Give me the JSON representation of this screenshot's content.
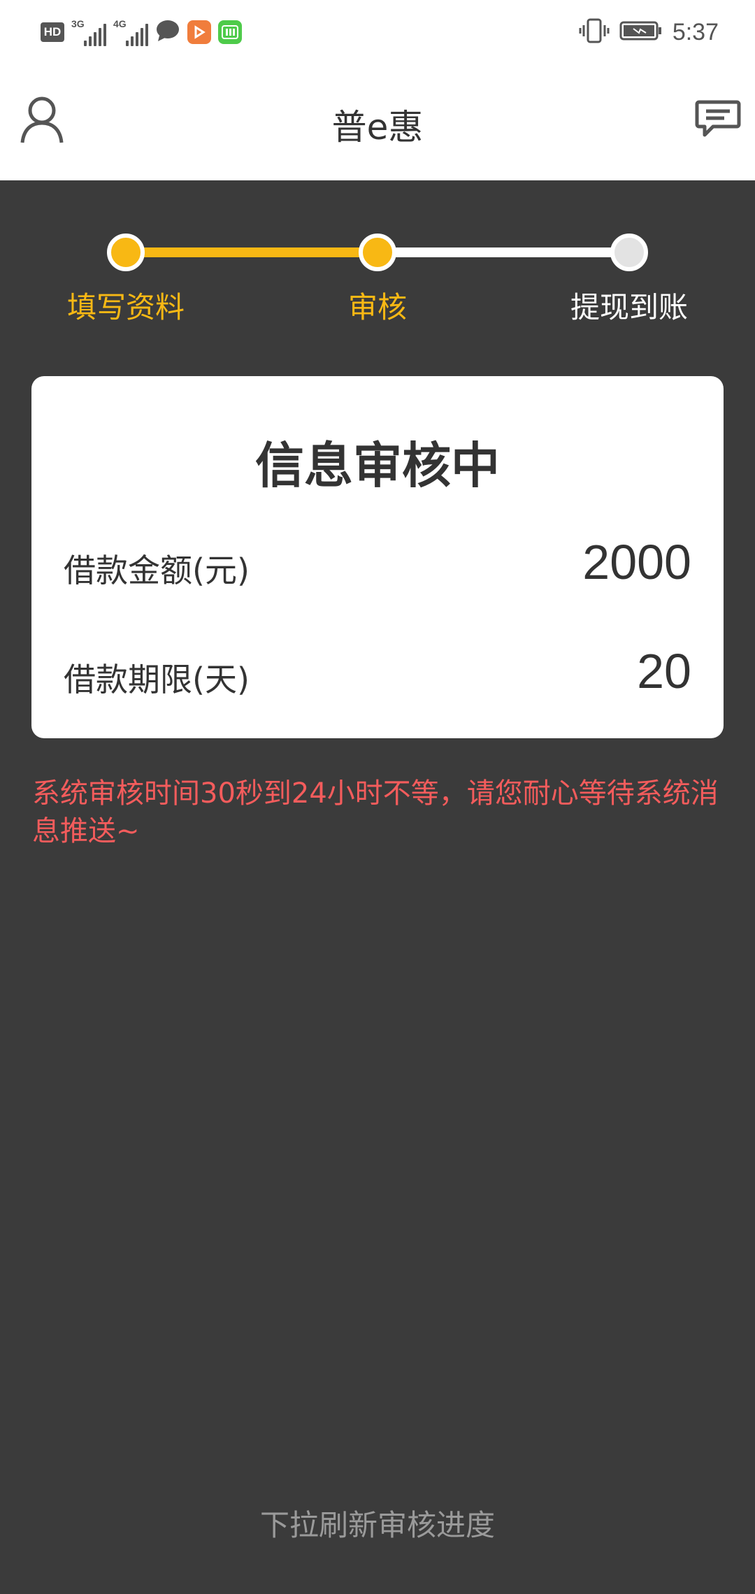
{
  "status_bar": {
    "hd_label": "HD",
    "net1_label": "3G",
    "net2_label": "4G",
    "time": "5:37",
    "icons": [
      "hd-icon",
      "signal-3g-icon",
      "signal-4g-icon",
      "chat-bubble-icon",
      "video-app-icon",
      "iqiyi-app-icon",
      "vibrate-icon",
      "battery-icon"
    ]
  },
  "header": {
    "title": "普e惠",
    "left_icon": "user-icon",
    "right_icon": "message-icon"
  },
  "steps": {
    "items": [
      {
        "label": "填写资料",
        "state": "done"
      },
      {
        "label": "审核",
        "state": "current"
      },
      {
        "label": "提现到账",
        "state": "pending"
      }
    ],
    "colors": {
      "active": "#f8b814",
      "inactive": "#ffffff"
    }
  },
  "card": {
    "title": "信息审核中",
    "rows": [
      {
        "label": "借款金额(元)",
        "value": "2000"
      },
      {
        "label": "借款期限(天)",
        "value": "20"
      }
    ]
  },
  "notice": "系统审核时间30秒到24小时不等，请您耐心等待系统消息推送~",
  "refresh_hint": "下拉刷新审核进度",
  "colors": {
    "background": "#3b3b3b",
    "accent": "#f8b814",
    "warning": "#f45c5c"
  }
}
